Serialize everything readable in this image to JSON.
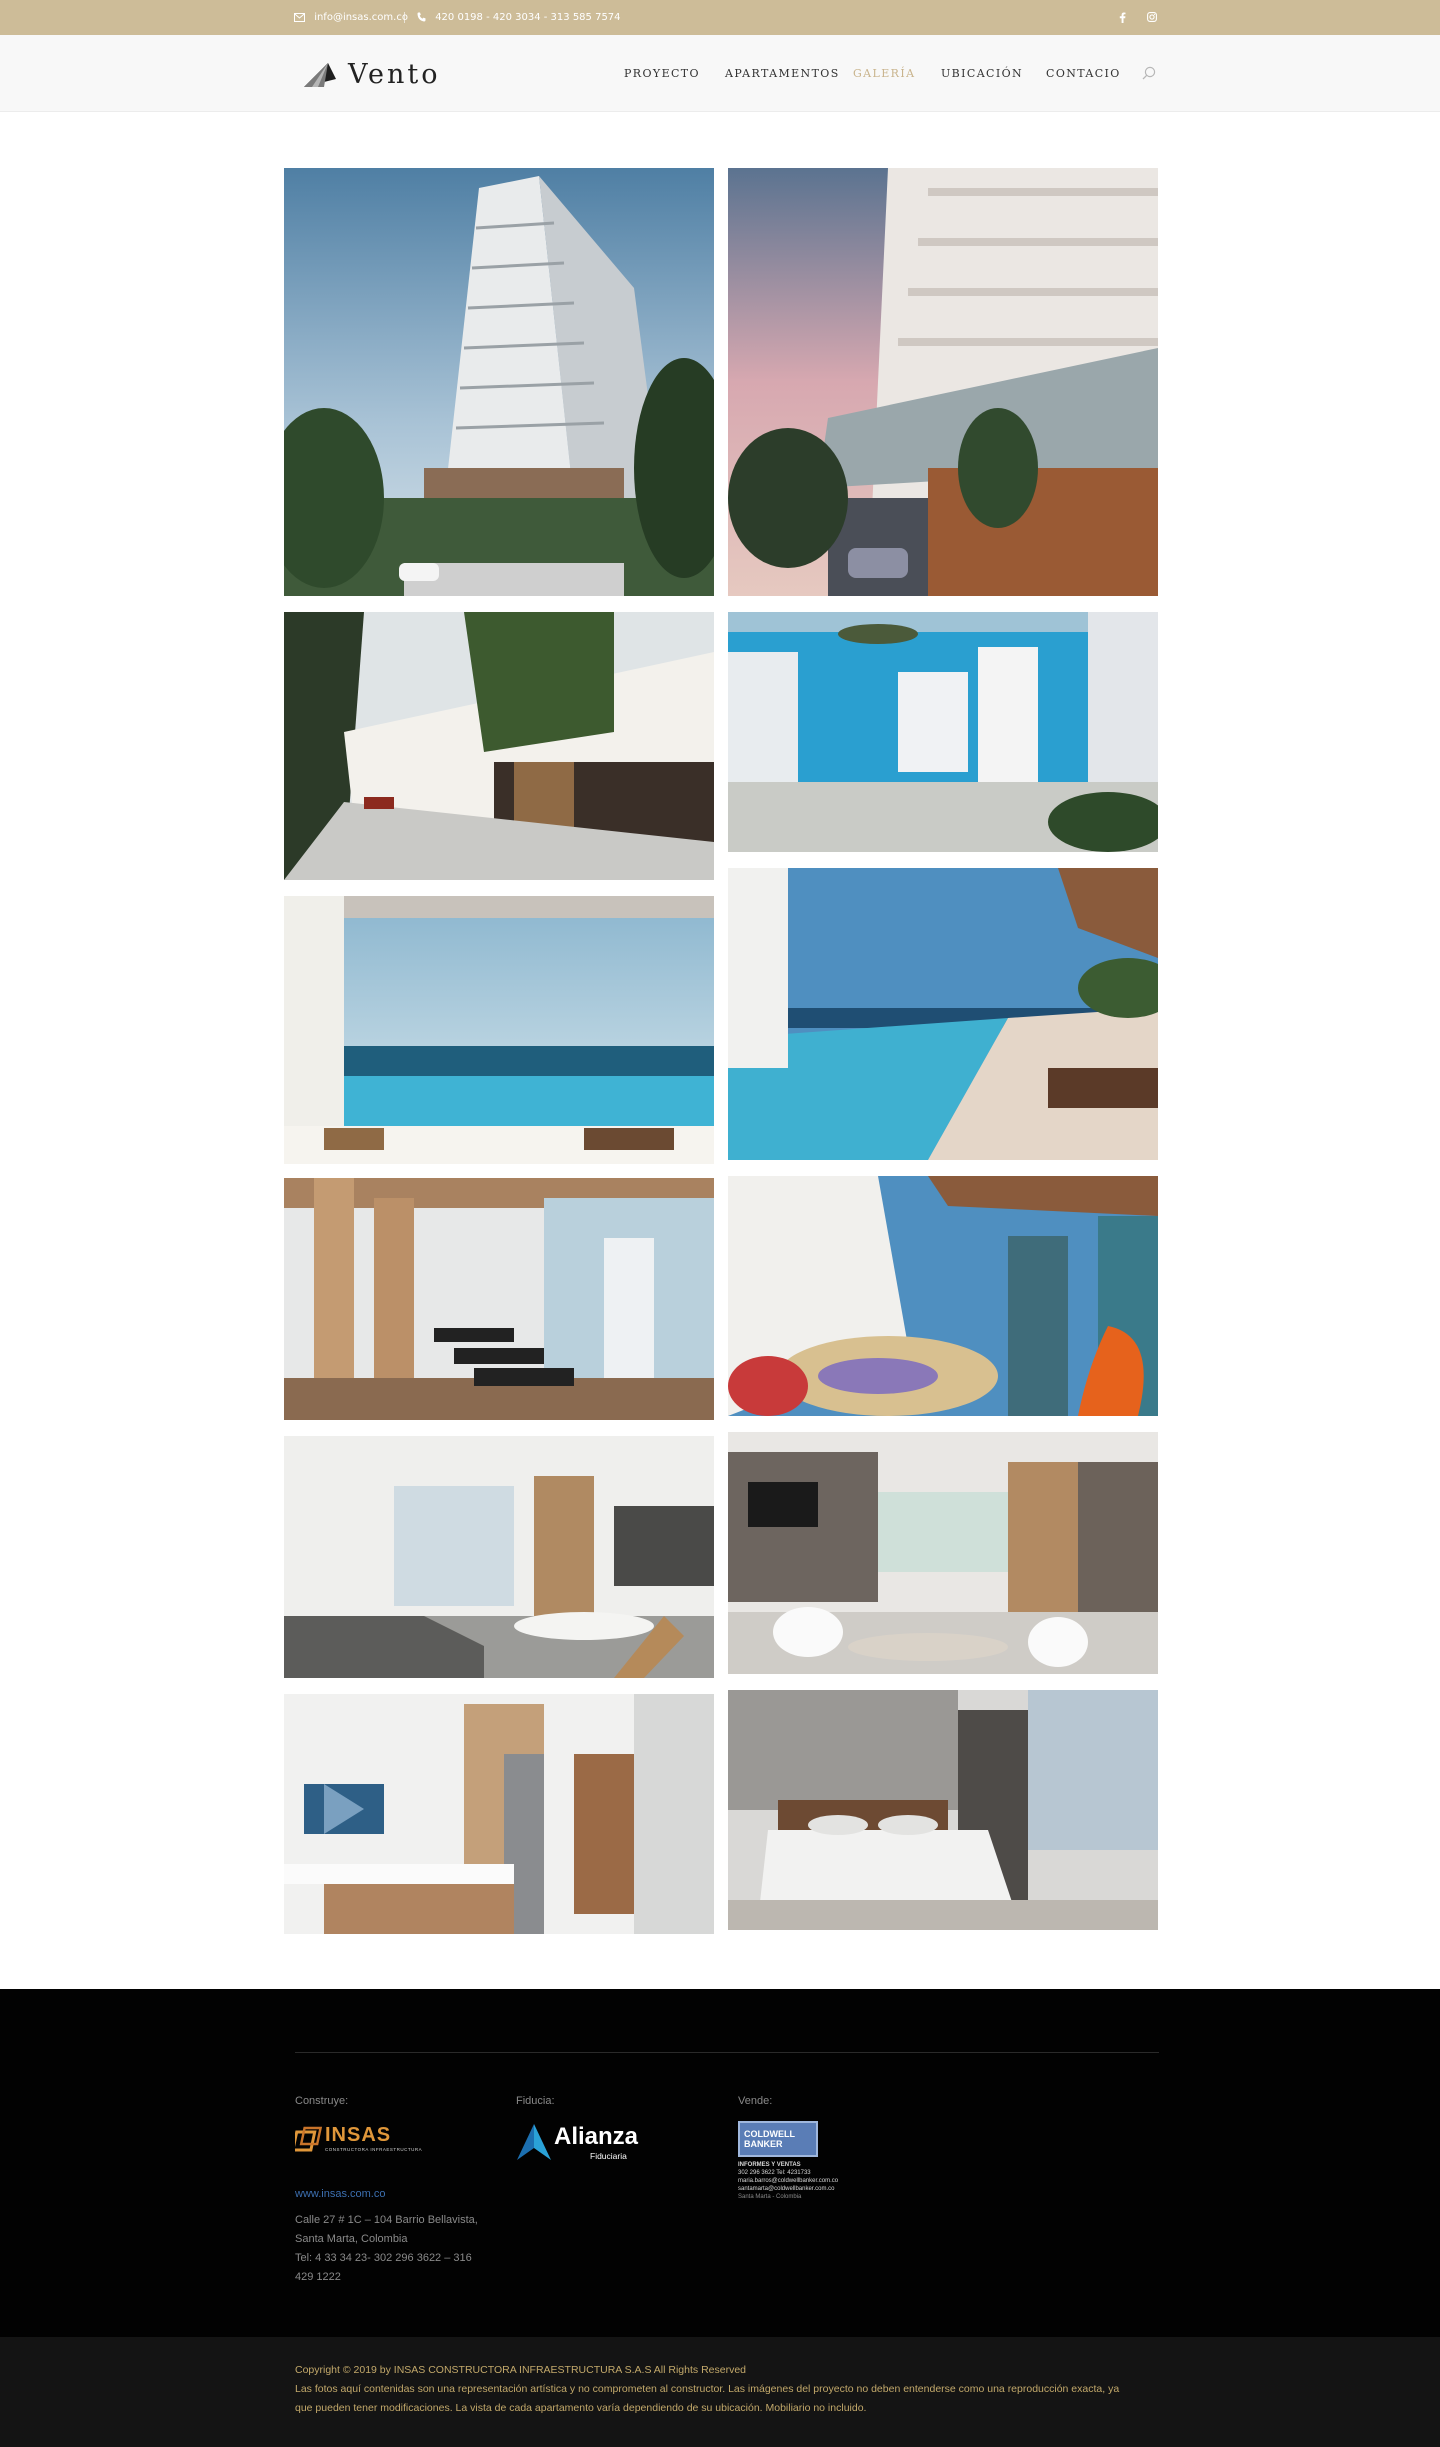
{
  "topbar": {
    "email": "info@insas.com.co",
    "phone": "420 0198 - 420 3034 - 313 585 7574",
    "social": [
      {
        "name": "facebook-icon",
        "glyph": "f"
      },
      {
        "name": "instagram-icon",
        "glyph": "ig"
      }
    ]
  },
  "header": {
    "logo_text": "Vento",
    "nav": [
      {
        "label": "PROYECTO",
        "active": false
      },
      {
        "label": "APARTAMENTOS",
        "active": false
      },
      {
        "label": "GALERÍA",
        "active": true
      },
      {
        "label": "UBICACIÓN",
        "active": false
      },
      {
        "label": "CONTACIO",
        "active": false
      }
    ],
    "active_color": "#c9b48d"
  },
  "gallery": {
    "images": [
      {
        "name": "gallery-image-tower-exterior",
        "subject": "tower exterior day"
      },
      {
        "name": "gallery-image-tower-dusk",
        "subject": "tower exterior dusk"
      },
      {
        "name": "gallery-image-entrance",
        "subject": "building entrance"
      },
      {
        "name": "gallery-image-aerial-bay",
        "subject": "aerial bay view"
      },
      {
        "name": "gallery-image-infinity-pool",
        "subject": "rooftop infinity pool"
      },
      {
        "name": "gallery-image-pool-terrace",
        "subject": "pool terrace"
      },
      {
        "name": "gallery-image-gym",
        "subject": "gym"
      },
      {
        "name": "gallery-image-kids-area",
        "subject": "kids play area"
      },
      {
        "name": "gallery-image-living-dining",
        "subject": "living dining room"
      },
      {
        "name": "gallery-image-lounge",
        "subject": "social lounge"
      },
      {
        "name": "gallery-image-kitchen",
        "subject": "kitchen"
      },
      {
        "name": "gallery-image-bedroom",
        "subject": "bedroom"
      }
    ]
  },
  "footer": {
    "columns": [
      {
        "label": "Construye:",
        "logo_text": "INSAS",
        "logo_sub": "CONSTRUCTORA INFRAESTRUCTURA"
      },
      {
        "label": "Fiducia:",
        "logo_text": "Alianza",
        "logo_sub": "Fiduciaria"
      },
      {
        "label": "Vende:",
        "logo_text": "COLDWELL BANKER"
      }
    ],
    "website": "www.insas.com.co",
    "address": [
      "Calle 27 # 1C – 104 Barrio Bellavista,",
      "Santa Marta, Colombia",
      "Tel: 4 33 34 23- 302 296 3622 – 316",
      "429 1222"
    ],
    "coldwell_info": {
      "title": "INFORMES Y VENTAS",
      "phone": "302 296 3622  Tel: 4231733",
      "mail1": "maria.barros@coldwellbanker.com.co",
      "mail2": "santamarta@coldwellbanker.com.co",
      "city": "Santa Marta - Colombia"
    }
  },
  "bottom": {
    "copyright": "Copyright © 2019 by INSAS CONSTRUCTORA INFRAESTRUCTURA S.A.S All Rights Reserved",
    "disclaimer_1": "Las fotos aquí contenidas son una representación artística y no comprometen al constructor. Las imágenes del proyecto no deben entenderse como una reproducción exacta, ya",
    "disclaimer_2": "que pueden tener modificaciones. La vista de cada apartamento varía dependiendo de su ubicación. Mobiliario no incluido."
  },
  "colors": {
    "topbar": "#cdbc98",
    "footer_bg": "#020202",
    "bottom_bg": "#141414",
    "copyright_text": "#c2a86a"
  }
}
